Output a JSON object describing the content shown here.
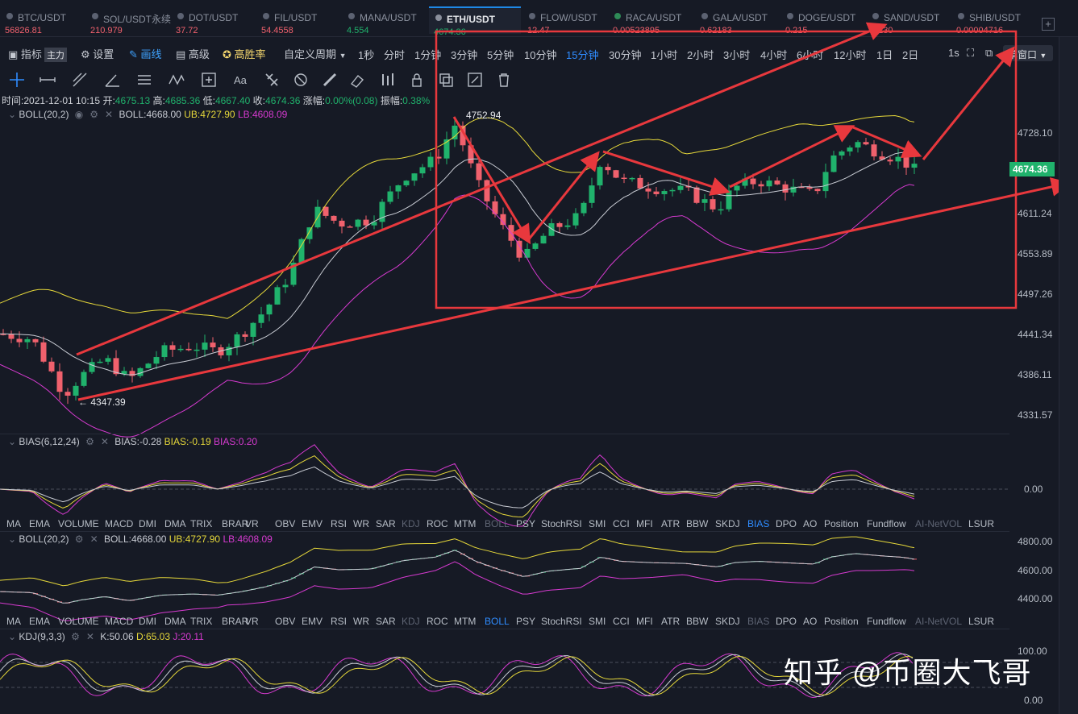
{
  "tickers": [
    {
      "symbol": "BTC/USDT",
      "price": "56826.81",
      "color": "#f0616d"
    },
    {
      "symbol": "SOL/USDT永续",
      "price": "210.979",
      "color": "#f0616d"
    },
    {
      "symbol": "DOT/USDT",
      "price": "37.72",
      "color": "#f0616d"
    },
    {
      "symbol": "FIL/USDT",
      "price": "54.4558",
      "color": "#f0616d"
    },
    {
      "symbol": "MANA/USDT",
      "price": "4.554",
      "color": "#20b26c"
    },
    {
      "symbol": "ETH/USDT",
      "price": "4674.36",
      "color": "#20b26c"
    },
    {
      "symbol": "FLOW/USDT",
      "price": "12.47",
      "color": "#f0616d"
    },
    {
      "symbol": "RACA/USDT",
      "price": "0.00523895",
      "color": "#f0616d"
    },
    {
      "symbol": "GALA/USDT",
      "price": "0.62183",
      "color": "#f0616d"
    },
    {
      "symbol": "DOGE/USDT",
      "price": "0.215",
      "color": "#f0616d"
    },
    {
      "symbol": "SAND/USDT",
      "price": "7.230",
      "color": "#f0616d"
    },
    {
      "symbol": "SHIB/USDT",
      "price": "0.00004716",
      "color": "#f0616d"
    }
  ],
  "toolbar": {
    "indicator": "指标",
    "main_badge": "主力",
    "settings": "设置",
    "draw": "画线",
    "advanced": "高级",
    "win_rate": "高胜率",
    "custom_period": "自定义周期",
    "periods": [
      "1秒",
      "分时",
      "1分钟",
      "3分钟",
      "5分钟",
      "10分钟",
      "15分钟",
      "30分钟",
      "1小时",
      "2小时",
      "3小时",
      "4小时",
      "6小时",
      "12小时",
      "1日",
      "2日"
    ],
    "active_period": "15分钟",
    "interval_1s": "1s",
    "window_mode": "单窗口"
  },
  "info": {
    "time_label": "时间:",
    "time": "2021-12-01 10:15",
    "open_label": "开:",
    "open": "4675.13",
    "high_label": "高:",
    "high": "4685.36",
    "low_label": "低:",
    "low": "4667.40",
    "close_label": "收:",
    "close": "4674.36",
    "change_label": "涨幅:",
    "change": "0.00%(0.08)",
    "amplitude_label": "振幅:",
    "amplitude": "0.38%"
  },
  "main_indicator": {
    "name": "BOLL(20,2)",
    "mid": "BOLL:4668.00",
    "ub": "UB:4727.90",
    "lb": "LB:4608.09"
  },
  "main_axis": [
    "4728.10",
    "4611.24",
    "4553.89",
    "4497.26",
    "4441.34",
    "4386.11",
    "4331.57"
  ],
  "current_price": "4674.36",
  "peak_label": "4752.94",
  "low_label": "4347.39",
  "bias_indicator": {
    "name": "BIAS(6,12,24)",
    "b1": "BIAS:-0.28",
    "b2": "BIAS:-0.19",
    "b3": "BIAS:0.20"
  },
  "bias_axis": [
    "0.00"
  ],
  "indicator_tabs": [
    "MA",
    "EMA",
    "VOLUME",
    "MACD",
    "DMI",
    "DMA",
    "TRIX",
    "BRAR",
    "VR",
    "OBV",
    "EMV",
    "RSI",
    "WR",
    "SAR",
    "KDJ",
    "ROC",
    "MTM",
    "BOLL",
    "PSY",
    "StochRSI",
    "SMI",
    "CCI",
    "MFI",
    "ATR",
    "BBW",
    "SKDJ",
    "BIAS",
    "DPO",
    "AO",
    "Position",
    "Fundflow",
    "AI-NetVOL",
    "LSUR"
  ],
  "tabs_row1_active": "BIAS",
  "tabs_row2_active": "BOLL",
  "boll_sub": {
    "name": "BOLL(20,2)",
    "mid": "BOLL:4668.00",
    "ub": "UB:4727.90",
    "lb": "LB:4608.09"
  },
  "boll_axis": [
    "4800.00",
    "4600.00",
    "4400.00"
  ],
  "kdj": {
    "name": "KDJ(9,3,3)",
    "k": "K:50.06",
    "d": "D:65.03",
    "j": "J:20.11"
  },
  "kdj_axis": [
    "100.00",
    "0.00"
  ],
  "watermark": "知乎 @币圈大飞哥",
  "colors": {
    "up": "#20b26c",
    "down": "#f0616d",
    "accent": "#2f8cff",
    "annotation": "#e8383d",
    "ub": "#e6d83a",
    "mid": "#c9ccd4",
    "lb": "#d63ad0"
  }
}
